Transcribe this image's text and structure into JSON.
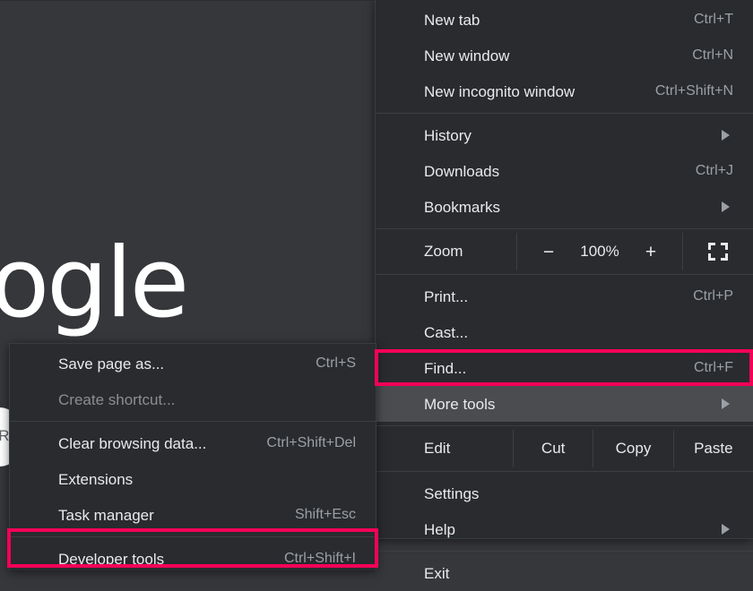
{
  "page": {
    "background_color": "#35373a",
    "wordmark_text": "oogle",
    "searchbox_fragment": "RL"
  },
  "colors": {
    "menu_background": "#292b2e",
    "menu_hover": "#4a4c4f",
    "text_primary": "#e8eaed",
    "text_secondary": "#9aa0a6",
    "text_disabled": "#8b8e92",
    "separator": "#3c3e41",
    "annotation_highlight": "#f50057"
  },
  "main_menu": {
    "groups": [
      {
        "items": [
          {
            "label": "New tab",
            "accel": "Ctrl+T",
            "submenu": false,
            "disabled": false,
            "hovered": false
          },
          {
            "label": "New window",
            "accel": "Ctrl+N",
            "submenu": false,
            "disabled": false,
            "hovered": false
          },
          {
            "label": "New incognito window",
            "accel": "Ctrl+Shift+N",
            "submenu": false,
            "disabled": false,
            "hovered": false
          }
        ]
      },
      {
        "items": [
          {
            "label": "History",
            "accel": "",
            "submenu": true,
            "disabled": false,
            "hovered": false
          },
          {
            "label": "Downloads",
            "accel": "Ctrl+J",
            "submenu": false,
            "disabled": false,
            "hovered": false
          },
          {
            "label": "Bookmarks",
            "accel": "",
            "submenu": true,
            "disabled": false,
            "hovered": false
          }
        ]
      }
    ],
    "zoom_row": {
      "label": "Zoom",
      "decrease_label": "−",
      "value": "100%",
      "increase_label": "+",
      "fullscreen_icon": "fullscreen-icon"
    },
    "group_print": {
      "items": [
        {
          "label": "Print...",
          "accel": "Ctrl+P",
          "submenu": false,
          "disabled": false,
          "hovered": false
        },
        {
          "label": "Cast...",
          "accel": "",
          "submenu": false,
          "disabled": false,
          "hovered": false
        },
        {
          "label": "Find...",
          "accel": "Ctrl+F",
          "submenu": false,
          "disabled": false,
          "hovered": false
        },
        {
          "label": "More tools",
          "accel": "",
          "submenu": true,
          "disabled": false,
          "hovered": true
        }
      ]
    },
    "edit_row": {
      "label": "Edit",
      "actions": [
        "Cut",
        "Copy",
        "Paste"
      ]
    },
    "group_settings": {
      "items": [
        {
          "label": "Settings",
          "accel": "",
          "submenu": false,
          "disabled": false,
          "hovered": false
        },
        {
          "label": "Help",
          "accel": "",
          "submenu": true,
          "disabled": false,
          "hovered": false
        }
      ]
    },
    "group_exit": {
      "items": [
        {
          "label": "Exit",
          "accel": "",
          "submenu": false,
          "disabled": false,
          "hovered": false
        }
      ]
    }
  },
  "more_tools_submenu": {
    "group_save": {
      "items": [
        {
          "label": "Save page as...",
          "accel": "Ctrl+S",
          "submenu": false,
          "disabled": false,
          "hovered": false
        },
        {
          "label": "Create shortcut...",
          "accel": "",
          "submenu": false,
          "disabled": true,
          "hovered": false
        }
      ]
    },
    "group_tools": {
      "items": [
        {
          "label": "Clear browsing data...",
          "accel": "Ctrl+Shift+Del",
          "submenu": false,
          "disabled": false,
          "hovered": false
        },
        {
          "label": "Extensions",
          "accel": "",
          "submenu": false,
          "disabled": false,
          "hovered": false
        },
        {
          "label": "Task manager",
          "accel": "Shift+Esc",
          "submenu": false,
          "disabled": false,
          "hovered": false
        }
      ]
    },
    "group_devtools": {
      "items": [
        {
          "label": "Developer tools",
          "accel": "Ctrl+Shift+I",
          "submenu": false,
          "disabled": false,
          "hovered": false
        }
      ]
    }
  },
  "annotations": [
    {
      "name": "more-tools-highlight",
      "target": "More tools"
    },
    {
      "name": "developer-tools-highlight",
      "target": "Developer tools"
    }
  ]
}
